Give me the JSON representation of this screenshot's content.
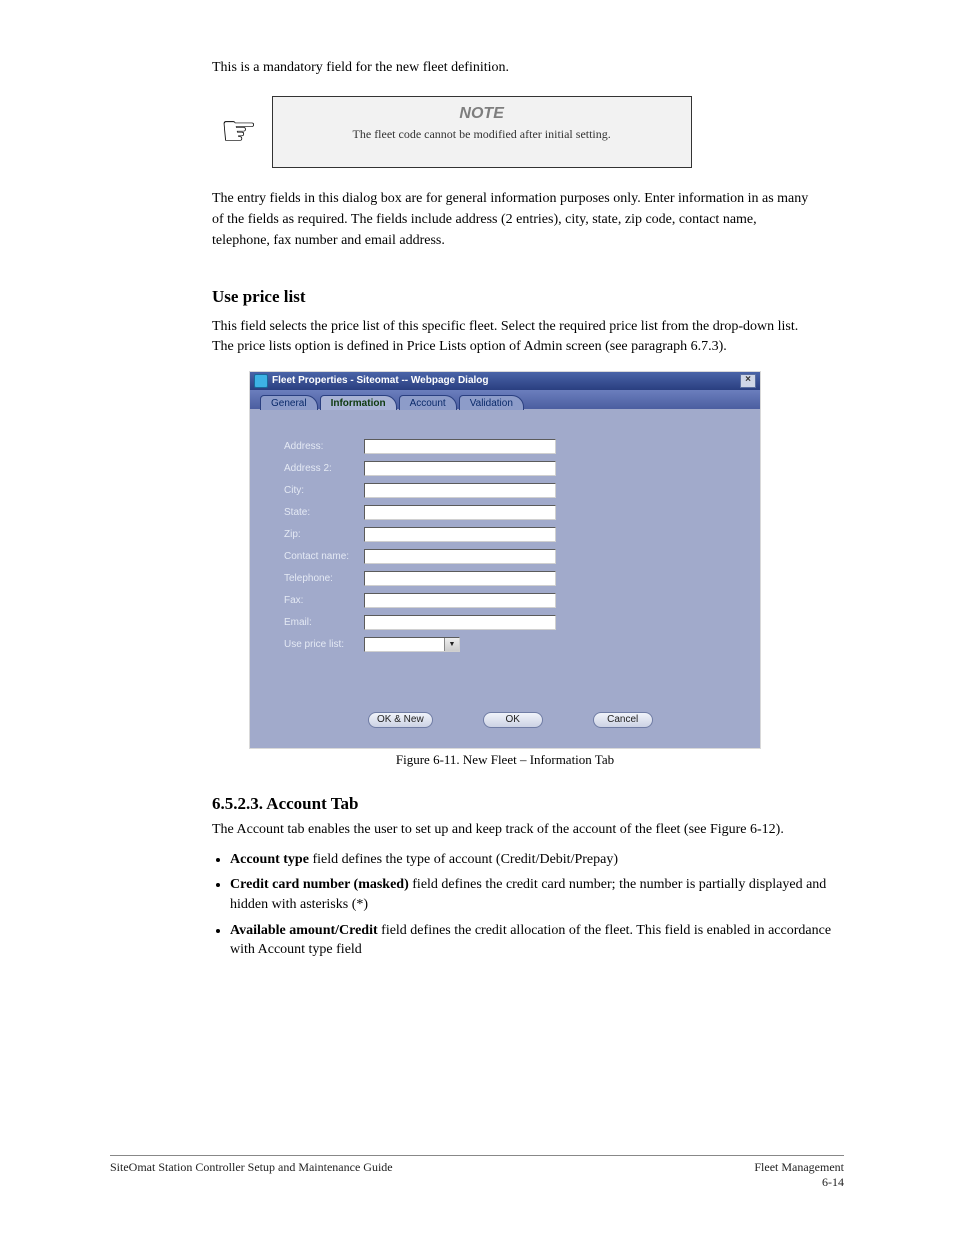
{
  "intro_line": "This is a mandatory field for the new fleet definition.",
  "note": {
    "title": "NOTE",
    "body": "The fleet code cannot be modified after initial setting."
  },
  "post_note_text": "The entry fields in this dialog box are for general information purposes only. Enter information in as many of the fields as required. The fields include address (2 entries), city, state, zip code, contact name, telephone, fax number and email address.",
  "use_price_list_heading": "Use price list",
  "use_price_list_desc": "This field selects the price list of this specific fleet. Select the required price list from the drop-down list. The price lists option is defined in Price Lists option of Admin screen (see paragraph 6.7.3).",
  "dialog": {
    "title": "Fleet Properties - Siteomat -- Webpage Dialog",
    "tabs": [
      "General",
      "Information",
      "Account",
      "Validation"
    ],
    "active_tab_index": 1,
    "labels": {
      "address": "Address:",
      "address2": "Address 2:",
      "city": "City:",
      "state": "State:",
      "zip": "Zip:",
      "contact": "Contact name:",
      "telephone": "Telephone:",
      "fax": "Fax:",
      "email": "Email:",
      "price_list": "Use price list:"
    },
    "values": {
      "address": "",
      "address2": "",
      "city": "",
      "state": "",
      "zip": "",
      "contact": "",
      "telephone": "",
      "fax": "",
      "email": "",
      "price_list": ""
    },
    "buttons": {
      "ok_new": "OK & New",
      "ok": "OK",
      "cancel": "Cancel"
    },
    "close_glyph": "×"
  },
  "figure_caption": "Figure 6-11. New Fleet – Information Tab",
  "account": {
    "heading": "6.5.2.3. Account Tab",
    "intro": "The Account tab enables the user to set up and keep track of the account of the fleet (see Figure 6-12).",
    "items": [
      {
        "label": "Account type",
        "desc": "field defines the type of account (Credit/Debit/Prepay)"
      },
      {
        "label": "Credit card number (masked)",
        "desc": "field defines the credit card number; the number is partially displayed and hidden with asterisks (*)"
      },
      {
        "label": "Available amount/Credit",
        "desc": "field defines the credit allocation of the fleet. This field is enabled in accordance with Account type field"
      }
    ]
  },
  "footer": {
    "left": "SiteOmat Station Controller Setup and Maintenance Guide",
    "right_line1": "Fleet Management",
    "right_line2": "6-14"
  }
}
